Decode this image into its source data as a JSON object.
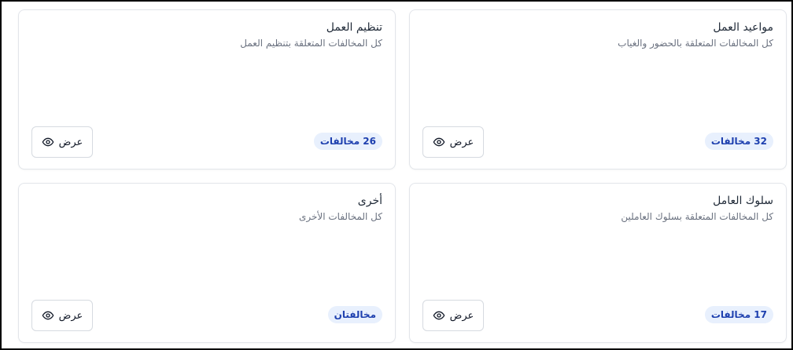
{
  "cards": [
    {
      "title": "مواعيد العمل",
      "description": "كل المخالفات المتعلقة بالحضور والغياب",
      "badge": "32 مخالفات",
      "view_label": "عرض",
      "view_icon": "eye-icon"
    },
    {
      "title": "تنظيم العمل",
      "description": "كل المخالفات المتعلقة بتنظيم العمل",
      "badge": "26 مخالفات",
      "view_label": "عرض",
      "view_icon": "eye-icon"
    },
    {
      "title": "سلوك العامل",
      "description": "كل المخالفات المتعلقة بسلوك العاملين",
      "badge": "17 مخالفات",
      "view_label": "عرض",
      "view_icon": "eye-icon"
    },
    {
      "title": "أخرى",
      "description": "كل المخالفات الأخرى",
      "badge": "مخالفتان",
      "view_label": "عرض",
      "view_icon": "eye-icon"
    }
  ],
  "colors": {
    "badge_bg": "#e8f0fd",
    "badge_text": "#1e40af",
    "card_border": "#e2e5ea"
  }
}
